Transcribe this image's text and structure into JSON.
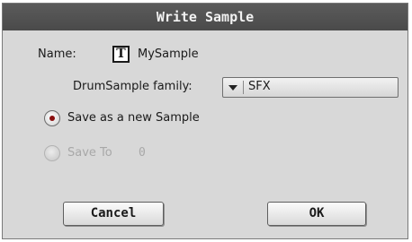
{
  "dialog": {
    "title": "Write Sample",
    "name_label": "Name:",
    "name_icon": "T",
    "name_value": "MySample",
    "family_label": "DrumSample family:",
    "family_value": "SFX",
    "radio_new_label": "Save as a new Sample",
    "radio_new_selected": true,
    "radio_saveto_label": "Save To",
    "radio_saveto_value": "0",
    "radio_saveto_enabled": false,
    "cancel_label": "Cancel",
    "ok_label": "OK"
  },
  "colors": {
    "titlebar": "#4f4f4f",
    "background": "#d8d8d8",
    "radio_dot": "#8a1010",
    "disabled_text": "#a8a8a8"
  }
}
